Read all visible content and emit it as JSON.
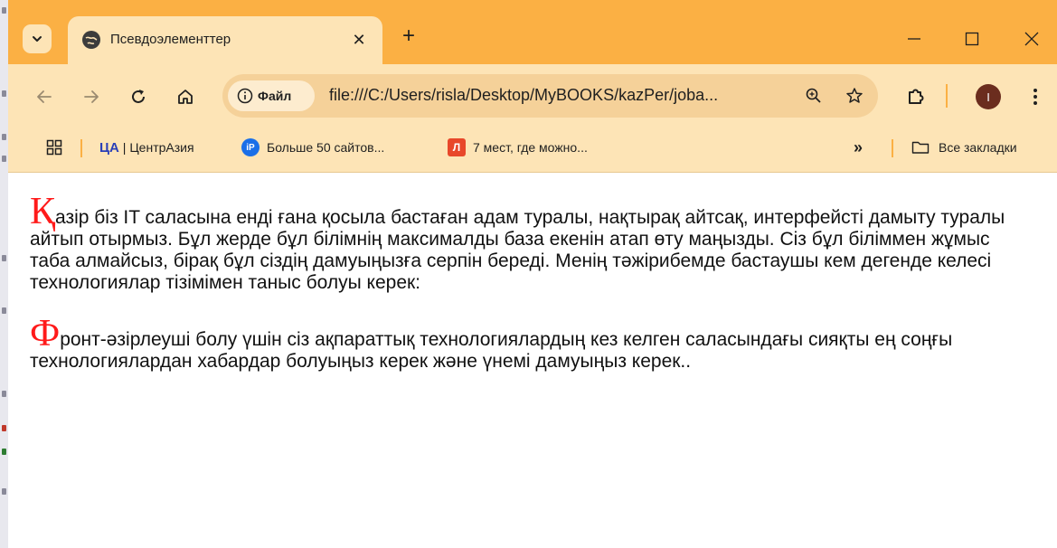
{
  "tab": {
    "title": "Псевдоэлементтер",
    "close_glyph": "✕",
    "new_tab_glyph": "+"
  },
  "toolbar": {
    "site_chip_label": "Файл",
    "url": "file:///C:/Users/risla/Desktop/MyBOOKS/kazPer/joba...",
    "profile_initial": "I"
  },
  "bookmarks": {
    "items": [
      {
        "logo": "ЦА",
        "label": "| ЦентрАзия"
      },
      {
        "logo": "iP",
        "label": "Больше 50 сайтов..."
      },
      {
        "logo": "Л",
        "label": "7 мест, где можно..."
      }
    ],
    "overflow_glyph": "»",
    "all_bookmarks_label": "Все закладки"
  },
  "page": {
    "paragraphs": [
      {
        "dropcap": "Қ",
        "text": "азір біз IT саласына енді ғана қосыла бастаған адам туралы, нақтырақ айтсақ, интерфейсті дамыту туралы айтып отырмыз. Бұл жерде бұл білімнің максималды база екенін атап өту маңызды. Сіз бұл біліммен жұмыс таба алмайсыз, бірақ бұл сіздің дамуыңызға серпін береді. Менің тәжірибемде бастаушы кем дегенде келесі технологиялар тізімімен таныс болуы керек:"
      },
      {
        "dropcap": "Ф",
        "text": "ронт-әзірлеуші болу үшін сіз ақпараттық технологиялардың кез келген саласындағы сияқты ең соңғы технологиялардан хабардар болуыңыз керек және үнемі дамуыңыз керек.."
      }
    ]
  },
  "theme": {
    "frame_color": "#fbb044",
    "toolbar_color": "#fde4b6",
    "dropcap_color": "#ff1a1a"
  }
}
